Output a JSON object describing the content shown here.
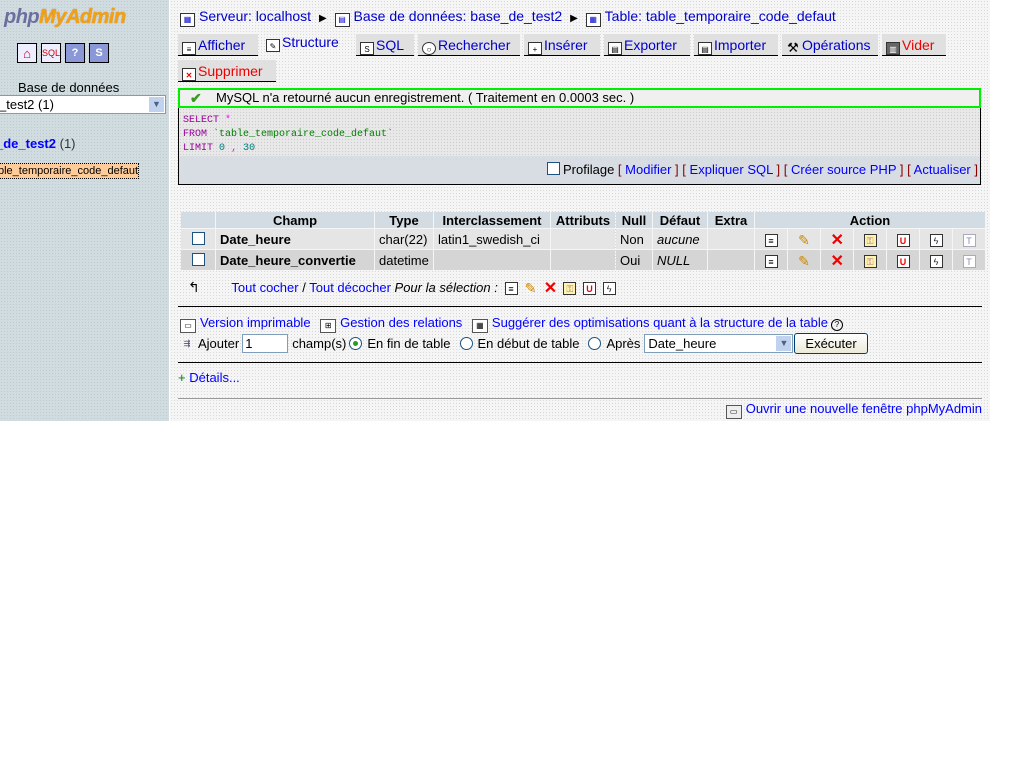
{
  "sidebar": {
    "logo_php": "php",
    "logo_myadmin": "MyAdmin",
    "icons": [
      "home-icon",
      "sql-query-window-icon",
      "help-icon",
      "sql-docs-icon"
    ],
    "db_label": "Base de données",
    "db_select_value": "_test2 (1)",
    "db_link": "_de_test2",
    "db_count": "(1)",
    "table_item": "ble_temporaire_code_defaut"
  },
  "breadcrumb": {
    "server": "Serveur: localhost",
    "database": "Base de données: base_de_test2",
    "table": "Table: table_temporaire_code_defaut"
  },
  "tabs": [
    {
      "label": "Afficher",
      "icon": "browse-icon",
      "active": false
    },
    {
      "label": "Structure",
      "icon": "structure-icon",
      "active": true
    },
    {
      "label": "SQL",
      "icon": "sql-icon",
      "active": false
    },
    {
      "label": "Rechercher",
      "icon": "search-icon",
      "active": false
    },
    {
      "label": "Insérer",
      "icon": "insert-icon",
      "active": false
    },
    {
      "label": "Exporter",
      "icon": "export-icon",
      "active": false
    },
    {
      "label": "Importer",
      "icon": "import-icon",
      "active": false
    },
    {
      "label": "Opérations",
      "icon": "operations-icon",
      "active": false
    },
    {
      "label": "Vider",
      "icon": "empty-icon",
      "active": false
    },
    {
      "label": "Supprimer",
      "icon": "drop-icon",
      "active": false
    }
  ],
  "message": "MySQL n'a retourné aucun enregistrement. ( Traitement en 0.0003 sec. )",
  "sql": {
    "select": "SELECT",
    "star": "*",
    "from": "FROM",
    "table": "`table_temporaire_code_defaut`",
    "limit": "LIMIT",
    "offset": "0",
    "comma": ",",
    "count": "30"
  },
  "sql_actions": {
    "profiling": "Profilage",
    "modify": "Modifier",
    "explain": "Expliquer SQL",
    "php_source": "Créer source PHP",
    "refresh": "Actualiser"
  },
  "structure": {
    "headers": [
      "Champ",
      "Type",
      "Interclassement",
      "Attributs",
      "Null",
      "Défaut",
      "Extra",
      "Action"
    ],
    "rows": [
      {
        "field": "Date_heure",
        "type": "char(22)",
        "collation": "latin1_swedish_ci",
        "attributes": "",
        "null": "Non",
        "default": "aucune",
        "extra": ""
      },
      {
        "field": "Date_heure_convertie",
        "type": "datetime",
        "collation": "",
        "attributes": "",
        "null": "Oui",
        "default": "NULL",
        "extra": ""
      }
    ],
    "action_icons": [
      "browse-distinct-icon",
      "edit-icon",
      "delete-icon",
      "primary-key-icon",
      "unique-icon",
      "index-icon",
      "fulltext-icon"
    ]
  },
  "selection": {
    "check_all": "Tout cocher",
    "separator": "/",
    "uncheck_all": "Tout décocher",
    "for_selection": "Pour la sélection :"
  },
  "links": {
    "print": "Version imprimable",
    "relations": "Gestion des relations",
    "optimize": "Suggérer des optimisations quant à la structure de la table"
  },
  "add_field": {
    "label": "Ajouter",
    "count_value": "1",
    "unit": "champ(s)",
    "opt_end": "En fin de table",
    "opt_start": "En début de table",
    "opt_after": "Après",
    "after_value": "Date_heure",
    "execute": "Exécuter",
    "selected": "end"
  },
  "details": "Détails...",
  "details_plus": "+",
  "new_window": "Ouvrir une nouvelle fenêtre phpMyAdmin"
}
